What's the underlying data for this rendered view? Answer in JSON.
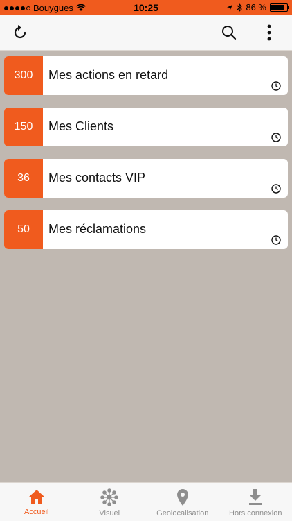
{
  "status_bar": {
    "carrier": "Bouygues",
    "time": "10:25",
    "battery": "86 %",
    "battery_level": 0.86,
    "background": "#f05b1e"
  },
  "toolbar": {
    "refresh_icon": "refresh-icon",
    "search_icon": "search-icon",
    "menu_icon": "more-vertical-icon"
  },
  "items": [
    {
      "count": "300",
      "label": "Mes actions en retard"
    },
    {
      "count": "150",
      "label": "Mes Clients"
    },
    {
      "count": "36",
      "label": "Mes contacts VIP"
    },
    {
      "count": "50",
      "label": "Mes réclamations"
    }
  ],
  "tabs": [
    {
      "label": "Accueil",
      "icon": "home-icon",
      "active": true
    },
    {
      "label": "Visuel",
      "icon": "network-icon",
      "active": false
    },
    {
      "label": "Geolocalisation",
      "icon": "location-pin-icon",
      "active": false
    },
    {
      "label": "Hors connexion",
      "icon": "download-icon",
      "active": false
    }
  ],
  "colors": {
    "accent": "#f05b1e",
    "background": "#c0b8b1",
    "inactive": "#8e8e8e"
  }
}
